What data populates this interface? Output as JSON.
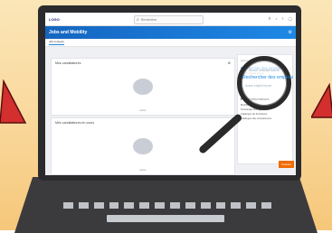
{
  "topbar": {
    "logo": "LOGO",
    "search_placeholder": "Rechercher"
  },
  "hero": {
    "title": "Jobs and Mobility"
  },
  "tabs": [
    {
      "label": "Job contexts"
    }
  ],
  "cards": [
    {
      "title": "Mes candidatures",
      "footer": "Aucun"
    },
    {
      "title": "Mes candidatures en cours",
      "footer": "Aucun"
    }
  ],
  "side_panel": {
    "top_small": "Aucun résultat trouvé",
    "search_jobs": "Rechercher des emplois",
    "hint": "Aucun emploi trouvé",
    "section_title": "Plus d'informations",
    "links": [
      "Mobilité interne",
      "Knowledge Management",
      "Catalogue de formations",
      "Catalogue des compétences"
    ]
  },
  "action_button": "Postuler",
  "colors": {
    "hero_blue": "#1565c0",
    "accent_orange": "#ef6c00",
    "background": "#f9d79a",
    "triangle_red": "#d32f2f"
  }
}
